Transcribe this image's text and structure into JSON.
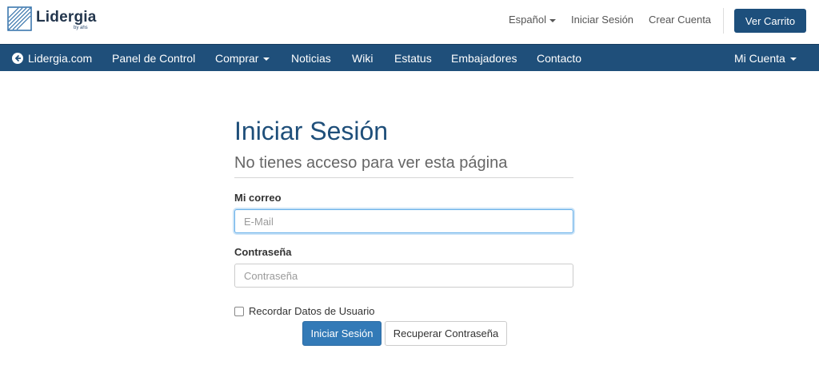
{
  "brand": {
    "name": "Lidergia",
    "byline": "by ahs"
  },
  "top_links": {
    "language": "Español",
    "login": "Iniciar Sesión",
    "register": "Crear Cuenta",
    "cart": "Ver Carrito"
  },
  "nav": {
    "home": "Lidergia.com",
    "items": [
      "Panel de Control",
      "Comprar",
      "Noticias",
      "Wiki",
      "Estatus",
      "Embajadores",
      "Contacto"
    ],
    "account": "Mi Cuenta"
  },
  "login": {
    "title": "Iniciar Sesión",
    "subtitle": "No tienes acceso para ver esta página",
    "email_label": "Mi correo",
    "email_placeholder": "E-Mail",
    "password_label": "Contraseña",
    "password_placeholder": "Contraseña",
    "remember_label": "Recordar Datos de Usuario",
    "submit_label": "Iniciar Sesión",
    "recover_label": "Recuperar Contraseña"
  },
  "colors": {
    "brand_dark": "#1f4f7a",
    "primary": "#337ab7",
    "focus": "#66afe9"
  }
}
